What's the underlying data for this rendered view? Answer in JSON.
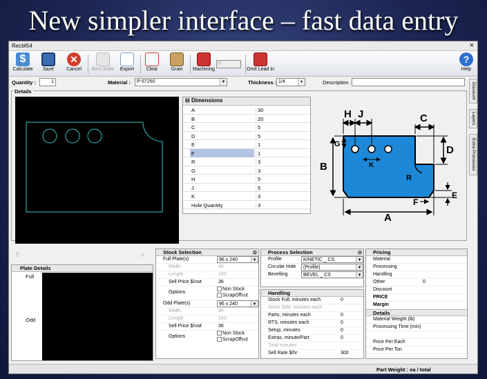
{
  "slide": {
    "title": "New simpler interface – fast data entry"
  },
  "window": {
    "title": "Rect#54",
    "close": "×"
  },
  "toolbar": {
    "buttons": [
      {
        "label": "Calculate",
        "icon": "dollar-icon"
      },
      {
        "label": "Save",
        "icon": "save-icon"
      },
      {
        "label": "Cancel",
        "icon": "cancel-icon"
      },
      {
        "label": "Best State",
        "icon": "chart-icon"
      },
      {
        "label": "Export",
        "icon": "export-icon"
      },
      {
        "label": "Clear",
        "icon": "clear-icon"
      },
      {
        "label": "Grain",
        "icon": "grain-icon"
      },
      {
        "label": "Machining",
        "icon": "machining-icon"
      },
      {
        "label": "Omit Lead In",
        "icon": "lead-in-icon"
      },
      {
        "label": "Help",
        "icon": "help-icon"
      }
    ],
    "machining_value": "0"
  },
  "form": {
    "quantity_label": "Quantity :",
    "quantity": "1",
    "material_label": "Material :",
    "material": "P-57250",
    "thickness_label": "Thickness :",
    "thickness": "1/4",
    "description_label": "Description :",
    "description": ""
  },
  "details": {
    "label": "Details"
  },
  "dimensions": {
    "header": "Dimensions",
    "rows": [
      {
        "k": "A",
        "v": "30"
      },
      {
        "k": "B",
        "v": "20"
      },
      {
        "k": "C",
        "v": "5"
      },
      {
        "k": "D",
        "v": "5"
      },
      {
        "k": "E",
        "v": "1"
      },
      {
        "k": "F",
        "v": "1"
      },
      {
        "k": "R",
        "v": "3"
      },
      {
        "k": "G",
        "v": "3"
      },
      {
        "k": "H",
        "v": "5"
      },
      {
        "k": "J",
        "v": "5"
      },
      {
        "k": "K",
        "v": "3"
      },
      {
        "k": "Hole Quantity",
        "v": "3"
      }
    ]
  },
  "diagram_labels": {
    "A": "A",
    "B": "B",
    "C": "C",
    "D": "D",
    "E": "E",
    "F": "F",
    "G": "G",
    "H": "H",
    "J": "J",
    "K": "K",
    "R": "R"
  },
  "side_tabs": [
    "Discount",
    "Layers",
    "Extra Processes"
  ],
  "plate_details": {
    "title": "Plate Details",
    "full": "Full",
    "odd": "Odd"
  },
  "stock": {
    "title": "Stock Selection",
    "full_label": "Full Plate(s)",
    "full_value": "96 x 240",
    "width_label": "Width",
    "width1": "96",
    "length_label": "Length",
    "length1": "240",
    "sell_label": "Sell Price $/cwt",
    "sell1": "36",
    "options_label": "Options",
    "opt_nonstock": "Non Stock",
    "opt_scrap": "ScrapOffcut",
    "odd_label": "Odd Plate(s)",
    "odd_value": "96 x 240",
    "width2": "96",
    "length2": "240",
    "sell2": "36"
  },
  "process": {
    "title": "Process Selection",
    "rows": [
      {
        "k": "Profile",
        "v": "KINETIC _ CS"
      },
      {
        "k": "Circular Hole",
        "v": "(Profile)"
      },
      {
        "k": "Bevelling",
        "v": "BEVEL _ CS"
      }
    ]
  },
  "handling": {
    "title": "Handling",
    "rows": [
      {
        "k": "Stock Full, minutes each",
        "v": "0"
      },
      {
        "k": "Stock Odd, minutes each",
        "v": ""
      },
      {
        "k": "Parts, minutes each",
        "v": "0"
      },
      {
        "k": "RTS, minutes each",
        "v": "0"
      },
      {
        "k": "Setup, minutes",
        "v": "0"
      },
      {
        "k": "Extras, minute/Part",
        "v": "0"
      },
      {
        "k": "Total minutes",
        "v": ""
      },
      {
        "k": "Sell Rate $/hr",
        "v": "300"
      }
    ]
  },
  "pricing": {
    "title": "Pricing",
    "rows": [
      {
        "k": "Material",
        "v": ""
      },
      {
        "k": "Processing",
        "v": ""
      },
      {
        "k": "Handling",
        "v": ""
      },
      {
        "k": "Other",
        "v": "0"
      },
      {
        "k": "Discount",
        "v": ""
      },
      {
        "k": "PRICE",
        "v": ""
      },
      {
        "k": "Margin",
        "v": ""
      }
    ],
    "details_title": "Details",
    "detail_rows": [
      {
        "k": "Material Weight (lb)",
        "v": ""
      },
      {
        "k": "Processing Time (min)",
        "v": ""
      },
      {
        "k": "",
        "v": ""
      },
      {
        "k": "Price Per Each",
        "v": ""
      },
      {
        "k": "Price Per Ton",
        "v": ""
      }
    ]
  },
  "status": {
    "part_weight": "Part Weight : ea /  total"
  },
  "colors": {
    "part_fill": "#1e88d8",
    "outline": "#36c8c8"
  }
}
